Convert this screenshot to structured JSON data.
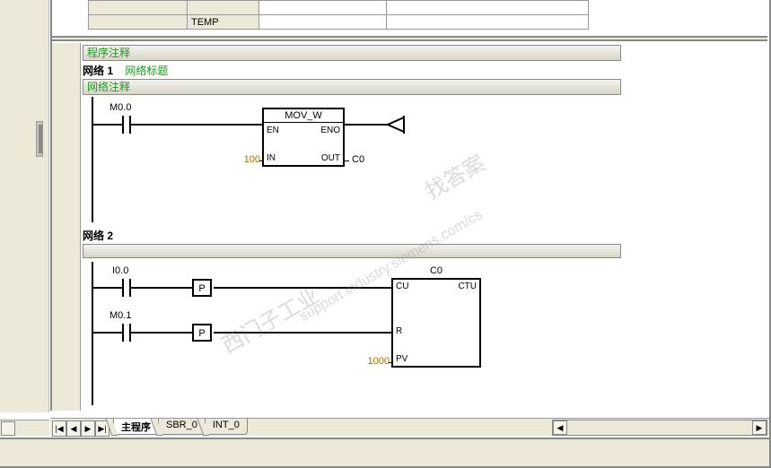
{
  "table": {
    "temp_label": "TEMP"
  },
  "program_comment": "程序注释",
  "net1": {
    "title_label": "网络 1",
    "subtitle": "网络标题",
    "comment": "网络注释",
    "contact": "M0.0",
    "block": {
      "name": "MOV_W",
      "en": "EN",
      "eno": "ENO",
      "in": "IN",
      "out": "OUT",
      "in_val": "100",
      "out_val": "C0"
    }
  },
  "net2": {
    "title_label": "网络 2",
    "contact_a": "I0.0",
    "contact_b": "M0.1",
    "p_label": "P",
    "counter": {
      "name": "C0",
      "cu": "CU",
      "ctu": "CTU",
      "r": "R",
      "pv": "PV",
      "pv_val": "1000"
    }
  },
  "tabs": {
    "main": "主程序",
    "sbr": "SBR_0",
    "int": "INT_0"
  },
  "watermarks": {
    "a": "找答案",
    "b": "西门子工业",
    "c": "support.industry.siemens.com/cs"
  },
  "nav": {
    "first": "|◀",
    "prev": "◀",
    "next": "▶",
    "last": "▶|"
  }
}
